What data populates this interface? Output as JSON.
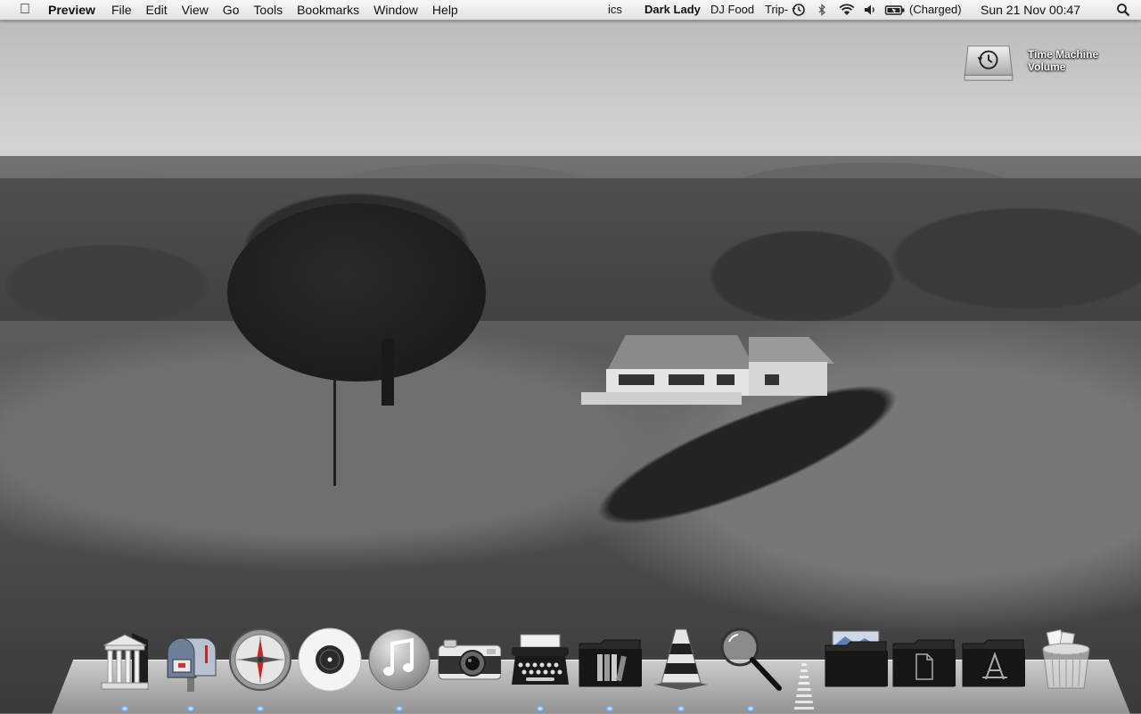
{
  "menubar": {
    "app_name": "Preview",
    "menus": [
      "File",
      "Edit",
      "View",
      "Go",
      "Tools",
      "Bookmarks",
      "Window",
      "Help"
    ],
    "status": {
      "track_fragment": "ics",
      "artist": "Dark Lady",
      "track": "DJ Food",
      "album_fragment": "Trip-",
      "battery": "(Charged)",
      "clock": "Sun 21 Nov  00:47"
    },
    "icons": [
      "apple-icon",
      "time-machine-icon",
      "bluetooth-icon",
      "wifi-icon",
      "volume-icon",
      "battery-icon",
      "spotlight-icon"
    ]
  },
  "desktop": {
    "icons": [
      {
        "label": "Time Machine Volume",
        "icon": "time-machine-drive-icon"
      }
    ]
  },
  "dock": {
    "items": [
      {
        "name": "library-app-icon",
        "running": true
      },
      {
        "name": "mail-mailbox-icon",
        "running": true
      },
      {
        "name": "safari-compass-icon",
        "running": true
      },
      {
        "name": "vinyl-record-icon",
        "running": false
      },
      {
        "name": "itunes-music-icon",
        "running": true
      },
      {
        "name": "camera-icon",
        "running": false
      },
      {
        "name": "typewriter-icon",
        "running": true
      },
      {
        "name": "books-folder-icon",
        "running": true
      },
      {
        "name": "vlc-cone-icon",
        "running": true
      },
      {
        "name": "magnifier-preview-icon",
        "running": true
      },
      {
        "name": "pictures-folder-icon",
        "running": false
      },
      {
        "name": "documents-folder-icon",
        "running": false
      },
      {
        "name": "applications-folder-icon",
        "running": false
      },
      {
        "name": "trash-icon",
        "running": false
      }
    ]
  },
  "colors": {
    "menubar": "#ececec",
    "dock_indicator": "#6fb2ff"
  }
}
